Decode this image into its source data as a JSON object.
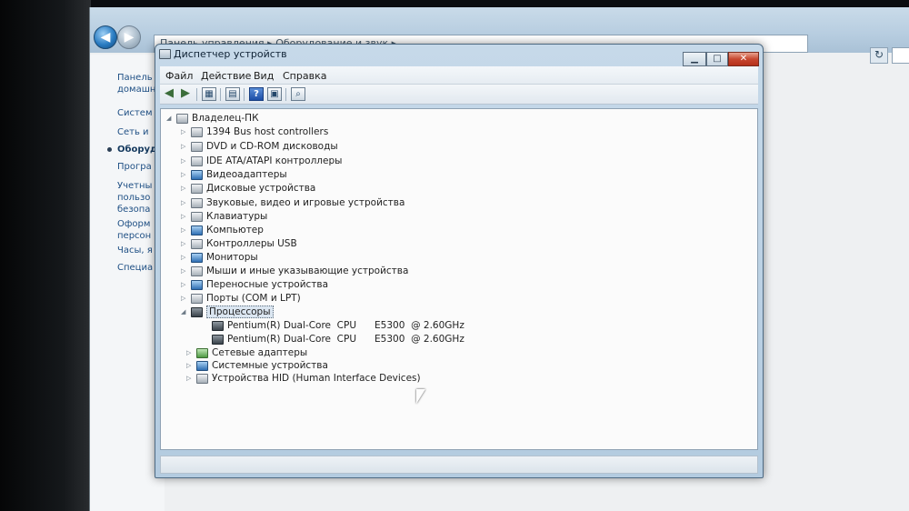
{
  "background_window": {
    "address_parts": [
      "Панель управления",
      "Оборудование и звук"
    ],
    "side_items": [
      "Панель",
      "домашн",
      "Систем",
      "Сеть и",
      "Оборуд",
      "Програ",
      "Учетны",
      "пользо",
      "безопа",
      "Оформ",
      "персон",
      "Часы, я",
      "Специа"
    ]
  },
  "window": {
    "title": "Диспетчер устройств",
    "buttons": {
      "minimize": "▁",
      "maximize": "□",
      "close": "✕"
    }
  },
  "menu": [
    "Файл",
    "Действие",
    "Вид",
    "Справка"
  ],
  "toolbar": {
    "icons": [
      "back-arrow-icon",
      "forward-arrow-icon",
      "properties-icon",
      "update-driver-icon",
      "help-icon",
      "view-icon",
      "scan-hardware-icon"
    ]
  },
  "tree": {
    "root": "Владелец-ПК",
    "categories": [
      "1394 Bus host controllers",
      "DVD и CD-ROM дисководы",
      "IDE ATA/ATAPI контроллеры",
      "Видеоадаптеры",
      "Дисковые устройства",
      "Звуковые, видео и игровые устройства",
      "Клавиатуры",
      "Компьютер",
      "Контроллеры USB",
      "Мониторы",
      "Мыши и иные указывающие устройства",
      "Переносные устройства",
      "Порты (COM и LPT)",
      "Процессоры"
    ],
    "processors": [
      "Pentium(R) Dual-Core  CPU      E5300  @ 2.60GHz",
      "Pentium(R) Dual-Core  CPU      E5300  @ 2.60GHz"
    ],
    "categories_after": [
      "Сетевые адаптеры",
      "Системные устройства",
      "Устройства HID (Human Interface Devices)"
    ]
  }
}
